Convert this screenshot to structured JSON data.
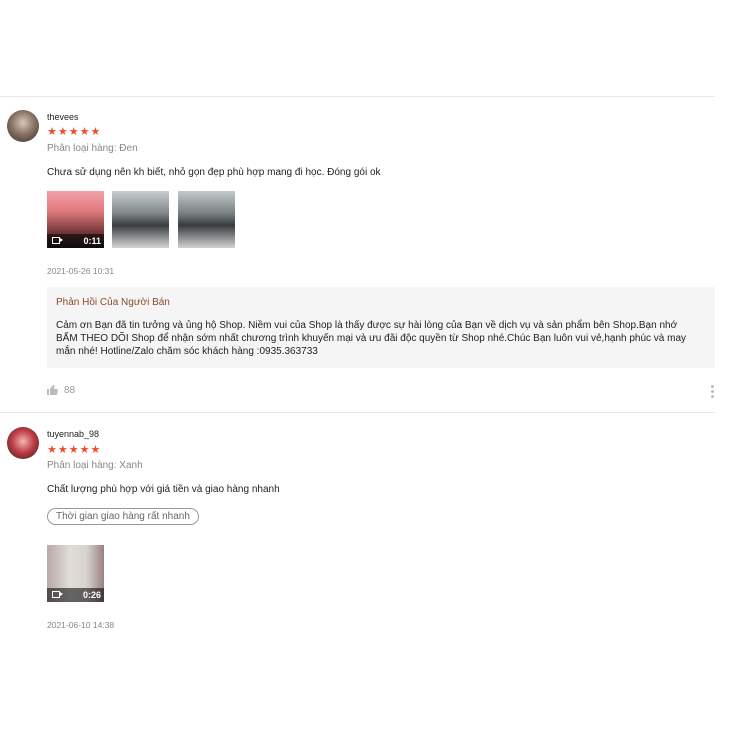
{
  "reviews": [
    {
      "username": "thevees",
      "stars": "★★★★★",
      "variant": "Phân loại hàng: Đen",
      "comment": "Chưa sử dụng nên kh biết, nhỏ gọn đẹp phù hợp mang đi học. Đóng gói ok",
      "media": [
        {
          "type": "video",
          "duration": "0:11"
        },
        {
          "type": "image"
        },
        {
          "type": "image"
        }
      ],
      "timestamp": "2021-05-26 10:31",
      "seller_reply": {
        "title": "Phản Hồi Của Người Bán",
        "body": "Cảm ơn Bạn đã tin tưởng và ủng hộ Shop. Niềm vui của Shop là thấy được sự hài lòng của Bạn về dịch vụ và sản phẩm bên Shop.Bạn nhớ BẤM THEO DÕI Shop để nhận sớm nhất chương trình khuyến mại và ưu đãi độc quyền từ Shop nhé.Chúc Bạn luôn vui vẻ,hạnh phúc và may mắn nhé! Hotline/Zalo chăm sóc khách hàng :0935.363733"
      },
      "likes": "88"
    },
    {
      "username": "tuyennab_98",
      "stars": "★★★★★",
      "variant": "Phân loại hàng: Xanh",
      "comment": "Chất lượng phù hợp với giá tiền và giao hàng nhanh",
      "tag": "Thời gian giao hàng rất nhanh",
      "media": [
        {
          "type": "video",
          "duration": "0:26"
        }
      ],
      "timestamp": "2021-06-10 14:38"
    }
  ],
  "colors": {
    "star": "#ee4d2d",
    "seller_title": "#8a4b2b",
    "reply_bg": "#f5f5f5"
  }
}
